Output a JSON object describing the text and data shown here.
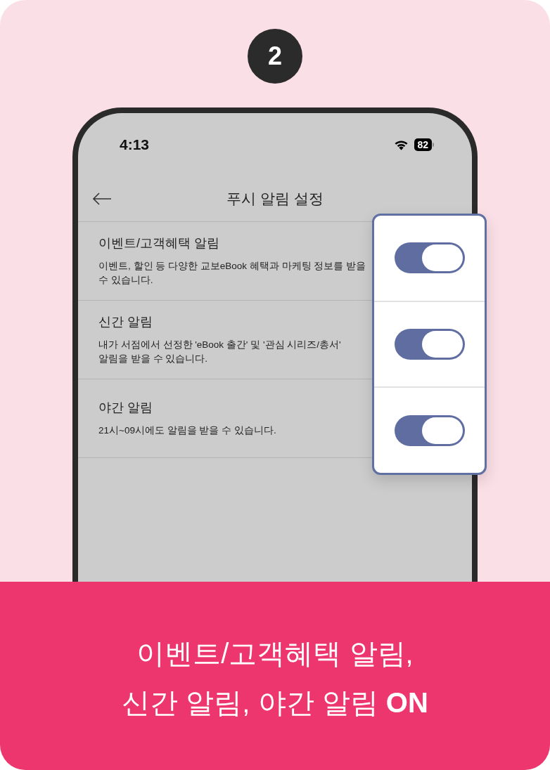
{
  "step": {
    "number": "2"
  },
  "phone": {
    "status_bar": {
      "time": "4:13",
      "battery": "82"
    },
    "header": {
      "title": "푸시 알림 설정"
    },
    "settings": [
      {
        "title": "이벤트/고객혜택 알림",
        "description": "이벤트, 할인 등 다양한 교보eBook 혜택과 마케팅 정보를 받을 수 있습니다.",
        "on": true
      },
      {
        "title": "신간 알림",
        "description": "내가 서점에서 선정한 'eBook 출간' 및 '관심 시리즈/총서' 알림을 받을 수 있습니다.",
        "on": true
      },
      {
        "title": "야간 알림",
        "description": "21시~09시에도 알림을 받을 수 있습니다.",
        "on": true
      }
    ]
  },
  "caption": {
    "lines": [
      "이벤트/고객혜택 알림,",
      "신간 알림, 야간 알림 **ON**"
    ]
  }
}
